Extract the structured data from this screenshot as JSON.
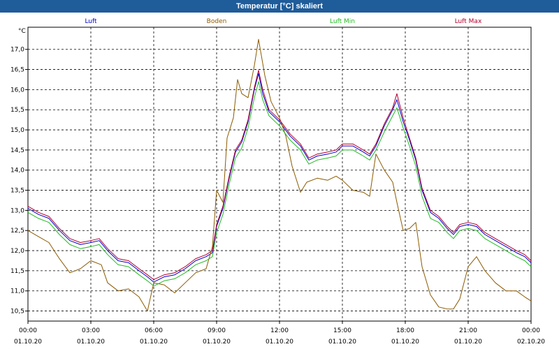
{
  "window": {
    "title": "Temperatur [°C] skaliert"
  },
  "chart_data": {
    "type": "line",
    "title": "Temperatur [°C] skaliert",
    "ylabel": "°C",
    "xlabel": "",
    "ylim": [
      10.25,
      17.55
    ],
    "yticks": [
      10.5,
      11.0,
      11.5,
      12.0,
      12.5,
      13.0,
      13.5,
      14.0,
      14.5,
      15.0,
      15.5,
      16.0,
      16.5,
      17.0
    ],
    "ytick_labels": [
      "10,5",
      "11,0",
      "11,5",
      "12,0",
      "12,5",
      "13,0",
      "13,5",
      "14,0",
      "14,5",
      "15,0",
      "15,5",
      "16,0",
      "16,5",
      "17,0"
    ],
    "xlim": [
      0,
      24
    ],
    "xticks": [
      0,
      3,
      6,
      9,
      12,
      15,
      18,
      21,
      24
    ],
    "xtick_times": [
      "00:00",
      "03:00",
      "06:00",
      "09:00",
      "12:00",
      "15:00",
      "18:00",
      "21:00",
      "00:00"
    ],
    "xtick_dates": [
      "01.10.20",
      "01.10.20",
      "01.10.20",
      "01.10.20",
      "01.10.20",
      "01.10.20",
      "01.10.20",
      "01.10.20",
      "02.10.20"
    ],
    "grid": true,
    "legend_position": "top",
    "series": [
      {
        "name": "Luft",
        "color": "#0000cc",
        "points": [
          [
            0,
            13.05
          ],
          [
            0.5,
            12.9
          ],
          [
            1,
            12.8
          ],
          [
            1.5,
            12.5
          ],
          [
            2,
            12.25
          ],
          [
            2.5,
            12.15
          ],
          [
            3,
            12.2
          ],
          [
            3.4,
            12.25
          ],
          [
            3.8,
            12.0
          ],
          [
            4.3,
            11.75
          ],
          [
            4.8,
            11.7
          ],
          [
            5.3,
            11.5
          ],
          [
            5.7,
            11.35
          ],
          [
            6,
            11.22
          ],
          [
            6.5,
            11.35
          ],
          [
            7,
            11.4
          ],
          [
            7.5,
            11.55
          ],
          [
            8,
            11.75
          ],
          [
            8.5,
            11.85
          ],
          [
            8.8,
            11.95
          ],
          [
            9,
            12.6
          ],
          [
            9.3,
            13.05
          ],
          [
            9.6,
            13.8
          ],
          [
            9.9,
            14.45
          ],
          [
            10.2,
            14.7
          ],
          [
            10.5,
            15.2
          ],
          [
            10.8,
            16.0
          ],
          [
            11,
            16.4
          ],
          [
            11.2,
            15.9
          ],
          [
            11.5,
            15.45
          ],
          [
            12,
            15.2
          ],
          [
            12.5,
            14.85
          ],
          [
            13,
            14.6
          ],
          [
            13.4,
            14.25
          ],
          [
            13.8,
            14.35
          ],
          [
            14.3,
            14.4
          ],
          [
            14.7,
            14.45
          ],
          [
            15,
            14.6
          ],
          [
            15.5,
            14.6
          ],
          [
            16,
            14.45
          ],
          [
            16.3,
            14.35
          ],
          [
            16.6,
            14.6
          ],
          [
            17,
            15.1
          ],
          [
            17.4,
            15.5
          ],
          [
            17.6,
            15.75
          ],
          [
            17.9,
            15.2
          ],
          [
            18.2,
            14.75
          ],
          [
            18.5,
            14.25
          ],
          [
            18.8,
            13.5
          ],
          [
            19.2,
            12.95
          ],
          [
            19.6,
            12.8
          ],
          [
            20,
            12.55
          ],
          [
            20.3,
            12.4
          ],
          [
            20.6,
            12.6
          ],
          [
            21,
            12.65
          ],
          [
            21.4,
            12.6
          ],
          [
            21.8,
            12.4
          ],
          [
            22.3,
            12.25
          ],
          [
            22.8,
            12.1
          ],
          [
            23.3,
            11.95
          ],
          [
            23.7,
            11.85
          ],
          [
            24,
            11.7
          ]
        ]
      },
      {
        "name": "Boden",
        "color": "#8b5a00",
        "points": [
          [
            0,
            12.5
          ],
          [
            0.5,
            12.35
          ],
          [
            1,
            12.2
          ],
          [
            1.5,
            11.8
          ],
          [
            2,
            11.45
          ],
          [
            2.5,
            11.55
          ],
          [
            3,
            11.75
          ],
          [
            3.5,
            11.65
          ],
          [
            3.8,
            11.2
          ],
          [
            4.3,
            11.0
          ],
          [
            4.8,
            11.05
          ],
          [
            5.3,
            10.85
          ],
          [
            5.7,
            10.5
          ],
          [
            6,
            11.2
          ],
          [
            6.5,
            11.15
          ],
          [
            7,
            10.95
          ],
          [
            7.5,
            11.2
          ],
          [
            8,
            11.45
          ],
          [
            8.5,
            11.55
          ],
          [
            8.8,
            12.1
          ],
          [
            9,
            13.5
          ],
          [
            9.3,
            13.2
          ],
          [
            9.5,
            14.8
          ],
          [
            9.8,
            15.3
          ],
          [
            10,
            16.25
          ],
          [
            10.2,
            15.9
          ],
          [
            10.5,
            15.8
          ],
          [
            10.8,
            16.6
          ],
          [
            11,
            17.25
          ],
          [
            11.3,
            16.35
          ],
          [
            11.6,
            15.7
          ],
          [
            12,
            15.3
          ],
          [
            12.3,
            14.85
          ],
          [
            12.6,
            14.1
          ],
          [
            13,
            13.45
          ],
          [
            13.3,
            13.7
          ],
          [
            13.8,
            13.8
          ],
          [
            14.3,
            13.75
          ],
          [
            14.7,
            13.85
          ],
          [
            15,
            13.75
          ],
          [
            15.5,
            13.5
          ],
          [
            16,
            13.45
          ],
          [
            16.3,
            13.35
          ],
          [
            16.6,
            14.4
          ],
          [
            17,
            14.0
          ],
          [
            17.4,
            13.7
          ],
          [
            17.6,
            13.2
          ],
          [
            17.9,
            12.5
          ],
          [
            18.2,
            12.55
          ],
          [
            18.5,
            12.7
          ],
          [
            18.8,
            11.6
          ],
          [
            19.2,
            10.9
          ],
          [
            19.6,
            10.6
          ],
          [
            20,
            10.55
          ],
          [
            20.3,
            10.55
          ],
          [
            20.6,
            10.8
          ],
          [
            21,
            11.6
          ],
          [
            21.4,
            11.85
          ],
          [
            21.8,
            11.5
          ],
          [
            22.3,
            11.2
          ],
          [
            22.8,
            11.0
          ],
          [
            23.3,
            11.0
          ],
          [
            23.7,
            10.85
          ],
          [
            24,
            10.75
          ]
        ]
      },
      {
        "name": "Luft Min",
        "color": "#22bb22",
        "points": [
          [
            0,
            12.95
          ],
          [
            0.5,
            12.8
          ],
          [
            1,
            12.7
          ],
          [
            1.5,
            12.4
          ],
          [
            2,
            12.15
          ],
          [
            2.5,
            12.05
          ],
          [
            3,
            12.1
          ],
          [
            3.4,
            12.15
          ],
          [
            3.8,
            11.9
          ],
          [
            4.3,
            11.65
          ],
          [
            4.8,
            11.6
          ],
          [
            5.3,
            11.4
          ],
          [
            5.7,
            11.25
          ],
          [
            6,
            11.12
          ],
          [
            6.5,
            11.25
          ],
          [
            7,
            11.3
          ],
          [
            7.5,
            11.45
          ],
          [
            8,
            11.65
          ],
          [
            8.5,
            11.75
          ],
          [
            8.8,
            11.85
          ],
          [
            9,
            12.45
          ],
          [
            9.3,
            12.9
          ],
          [
            9.6,
            13.65
          ],
          [
            9.9,
            14.3
          ],
          [
            10.2,
            14.55
          ],
          [
            10.5,
            15.05
          ],
          [
            10.8,
            15.8
          ],
          [
            11,
            16.2
          ],
          [
            11.2,
            15.75
          ],
          [
            11.5,
            15.35
          ],
          [
            12,
            15.1
          ],
          [
            12.5,
            14.75
          ],
          [
            13,
            14.5
          ],
          [
            13.4,
            14.15
          ],
          [
            13.8,
            14.25
          ],
          [
            14.3,
            14.3
          ],
          [
            14.7,
            14.35
          ],
          [
            15,
            14.5
          ],
          [
            15.5,
            14.5
          ],
          [
            16,
            14.35
          ],
          [
            16.3,
            14.25
          ],
          [
            16.6,
            14.5
          ],
          [
            17,
            14.95
          ],
          [
            17.4,
            15.35
          ],
          [
            17.6,
            15.55
          ],
          [
            17.9,
            15.05
          ],
          [
            18.2,
            14.6
          ],
          [
            18.5,
            14.1
          ],
          [
            18.8,
            13.35
          ],
          [
            19.2,
            12.8
          ],
          [
            19.6,
            12.7
          ],
          [
            20,
            12.45
          ],
          [
            20.3,
            12.3
          ],
          [
            20.6,
            12.5
          ],
          [
            21,
            12.55
          ],
          [
            21.4,
            12.5
          ],
          [
            21.8,
            12.3
          ],
          [
            22.3,
            12.15
          ],
          [
            22.8,
            12.0
          ],
          [
            23.3,
            11.85
          ],
          [
            23.7,
            11.75
          ],
          [
            24,
            11.6
          ]
        ]
      },
      {
        "name": "Luft Max",
        "color": "#b00030",
        "points": [
          [
            0,
            13.1
          ],
          [
            0.5,
            12.95
          ],
          [
            1,
            12.85
          ],
          [
            1.5,
            12.55
          ],
          [
            2,
            12.3
          ],
          [
            2.5,
            12.2
          ],
          [
            3,
            12.25
          ],
          [
            3.4,
            12.3
          ],
          [
            3.8,
            12.05
          ],
          [
            4.3,
            11.8
          ],
          [
            4.8,
            11.75
          ],
          [
            5.3,
            11.55
          ],
          [
            5.7,
            11.4
          ],
          [
            6,
            11.28
          ],
          [
            6.5,
            11.4
          ],
          [
            7,
            11.45
          ],
          [
            7.5,
            11.6
          ],
          [
            8,
            11.8
          ],
          [
            8.5,
            11.9
          ],
          [
            8.8,
            12.0
          ],
          [
            9,
            12.65
          ],
          [
            9.3,
            13.1
          ],
          [
            9.6,
            13.85
          ],
          [
            9.9,
            14.5
          ],
          [
            10.2,
            14.75
          ],
          [
            10.5,
            15.25
          ],
          [
            10.8,
            16.05
          ],
          [
            11,
            16.48
          ],
          [
            11.2,
            16.0
          ],
          [
            11.5,
            15.5
          ],
          [
            12,
            15.25
          ],
          [
            12.5,
            14.9
          ],
          [
            13,
            14.65
          ],
          [
            13.4,
            14.3
          ],
          [
            13.8,
            14.4
          ],
          [
            14.3,
            14.45
          ],
          [
            14.7,
            14.5
          ],
          [
            15,
            14.65
          ],
          [
            15.5,
            14.65
          ],
          [
            16,
            14.5
          ],
          [
            16.3,
            14.4
          ],
          [
            16.6,
            14.65
          ],
          [
            17,
            15.15
          ],
          [
            17.4,
            15.55
          ],
          [
            17.6,
            15.9
          ],
          [
            17.9,
            15.3
          ],
          [
            18.2,
            14.8
          ],
          [
            18.5,
            14.3
          ],
          [
            18.8,
            13.55
          ],
          [
            19.2,
            13.0
          ],
          [
            19.6,
            12.85
          ],
          [
            20,
            12.6
          ],
          [
            20.3,
            12.45
          ],
          [
            20.6,
            12.65
          ],
          [
            21,
            12.7
          ],
          [
            21.4,
            12.65
          ],
          [
            21.8,
            12.45
          ],
          [
            22.3,
            12.3
          ],
          [
            22.8,
            12.15
          ],
          [
            23.3,
            12.0
          ],
          [
            23.7,
            11.9
          ],
          [
            24,
            11.75
          ]
        ]
      }
    ]
  }
}
